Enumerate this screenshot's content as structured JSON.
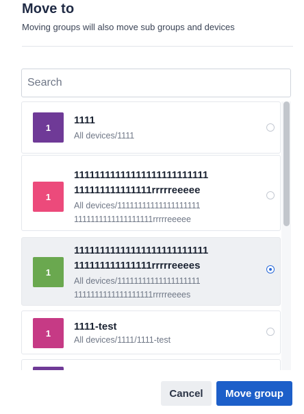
{
  "dialog": {
    "title": "Move to",
    "subtitle": "Moving groups will also move sub groups and devices"
  },
  "search": {
    "placeholder": "Search",
    "value": ""
  },
  "groups": [
    {
      "avatar_text": "1",
      "avatar_color": "#6f3a97",
      "name": "1111",
      "path": "All devices/1111",
      "selected": false
    },
    {
      "avatar_text": "1",
      "avatar_color": "#ec4a7b",
      "name": "11111111111111111111111111\n111111111111111rrrrreeeee",
      "path": "All devices/11111111111111111111\n1111111111111111111rrrrreeeee",
      "selected": false
    },
    {
      "avatar_text": "1",
      "avatar_color": "#6aa84f",
      "name": "11111111111111111111111111\n111111111111111rrrrreeees",
      "path": "All devices/11111111111111111111\n1111111111111111111rrrrreeees",
      "selected": true
    },
    {
      "avatar_text": "1",
      "avatar_color": "#c63a85",
      "name": "1111-test",
      "path": "All devices/1111/1111-test",
      "selected": false
    },
    {
      "avatar_text": "",
      "avatar_color": "#6f3a97",
      "name": "",
      "path": "",
      "selected": false
    }
  ],
  "actions": {
    "cancel_label": "Cancel",
    "move_label": "Move group"
  }
}
